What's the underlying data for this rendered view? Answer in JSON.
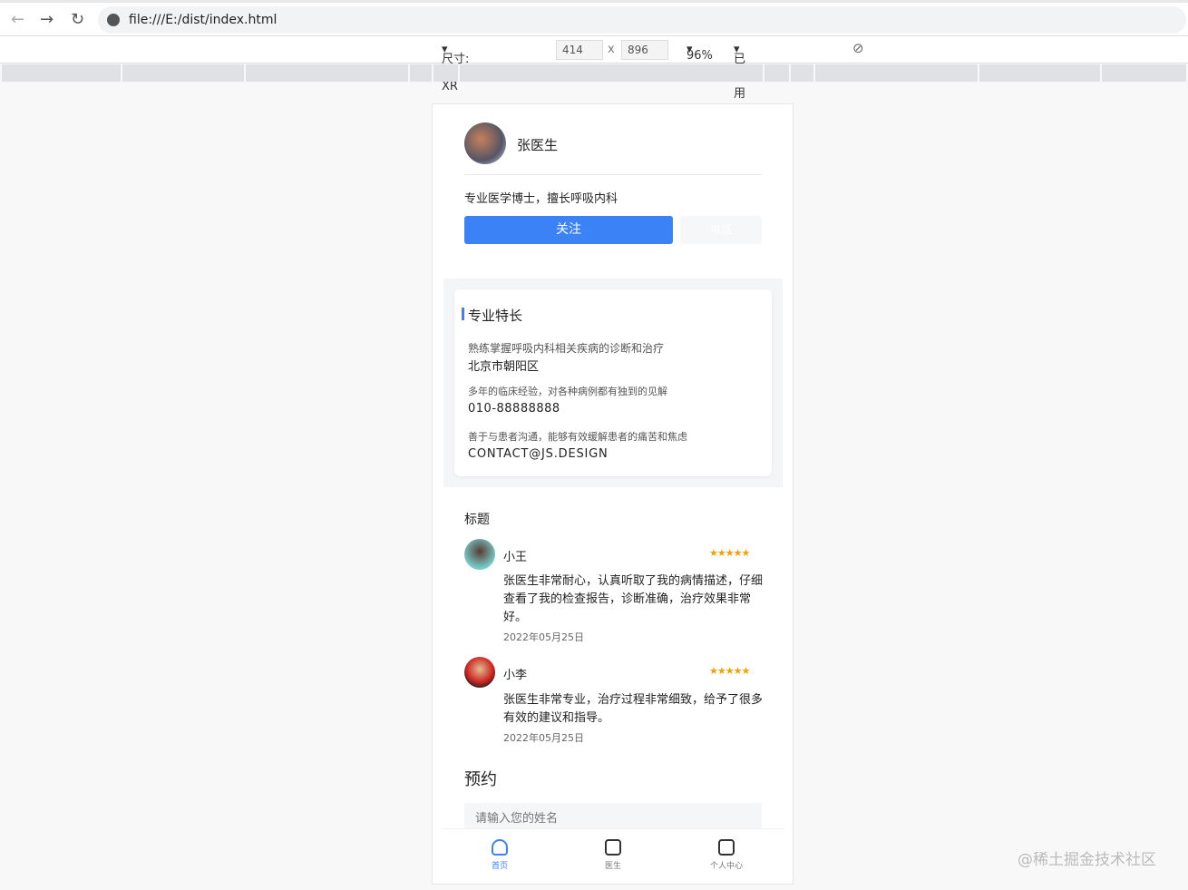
{
  "browser": {
    "url": "file:///E:/dist/index.html",
    "device_label": "尺寸: iPhone XR",
    "width": "414",
    "x": "x",
    "height": "896",
    "zoom": "96%",
    "throttle": "已停用节流模式"
  },
  "doctor": {
    "name": "张医生",
    "intro": "专业医学博士，擅长呼吸内科",
    "follow": "关注",
    "secondary": "电话"
  },
  "specialty": {
    "title": "专业特长",
    "items": [
      {
        "desc": "熟练掌握呼吸内科相关疾病的诊断和治疗",
        "value": "北京市朝阳区"
      },
      {
        "desc": "多年的临床经验，对各种病例都有独到的见解",
        "value": "010-88888888"
      },
      {
        "desc": "善于与患者沟通，能够有效缓解患者的痛苦和焦虑",
        "value": "CONTACT@JS.DESIGN"
      }
    ]
  },
  "reviews": {
    "title": "标题",
    "items": [
      {
        "name": "小王",
        "stars": "★★★★★",
        "rating": 5,
        "text": "张医生非常耐心，认真听取了我的病情描述，仔细查看了我的检查报告，诊断准确，治疗效果非常好。",
        "date": "2022年05月25日"
      },
      {
        "name": "小李",
        "stars": "★★★★★",
        "rating": 5,
        "text": "张医生非常专业，治疗过程非常细致，给予了很多有效的建议和指导。",
        "date": "2022年05月25日"
      }
    ]
  },
  "booking": {
    "title": "预约",
    "name_placeholder": "请输入您的姓名"
  },
  "tabbar": [
    {
      "label": "首页"
    },
    {
      "label": "医生"
    },
    {
      "label": "个人中心"
    }
  ],
  "watermark": "@稀土掘金技术社区",
  "colors": {
    "primary": "#3b82f6",
    "star": "#f5a000"
  }
}
